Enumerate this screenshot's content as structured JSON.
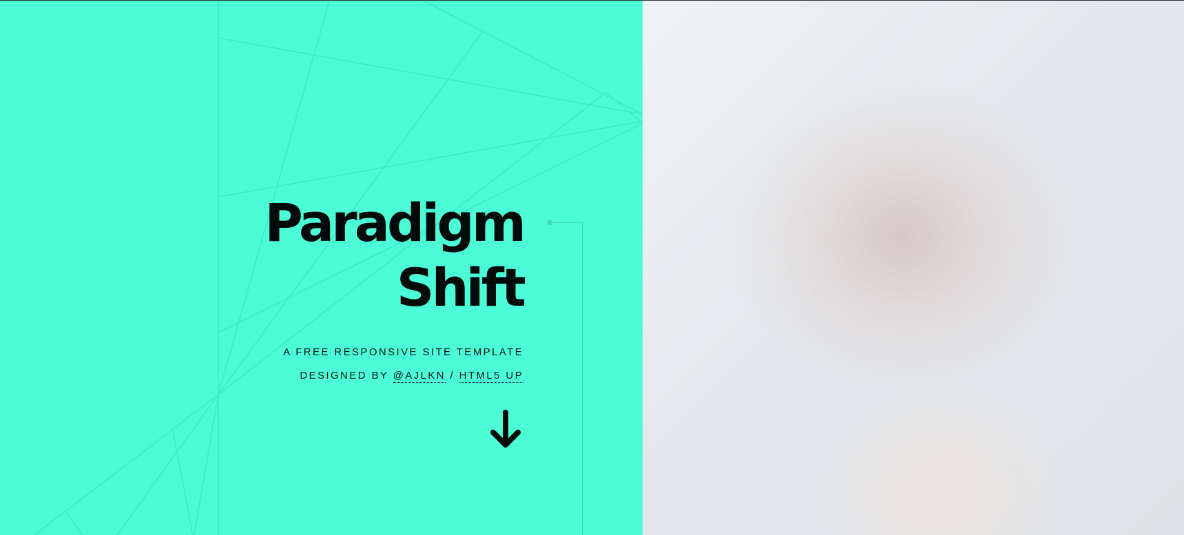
{
  "hero": {
    "title_line1": "Paradigm",
    "title_line2": "Shift",
    "subtitle": "A FREE RESPONSIVE SITE TEMPLATE",
    "designed_by_prefix": "DESIGNED BY",
    "author_link": "@AJLKN",
    "separator": "/",
    "html5up_link": "HTML5 UP"
  },
  "icons": {
    "scroll": "arrow-down-icon"
  },
  "colors": {
    "accent": "#4bfcd7",
    "text": "#020b0a",
    "line": "#3ee6c2"
  }
}
